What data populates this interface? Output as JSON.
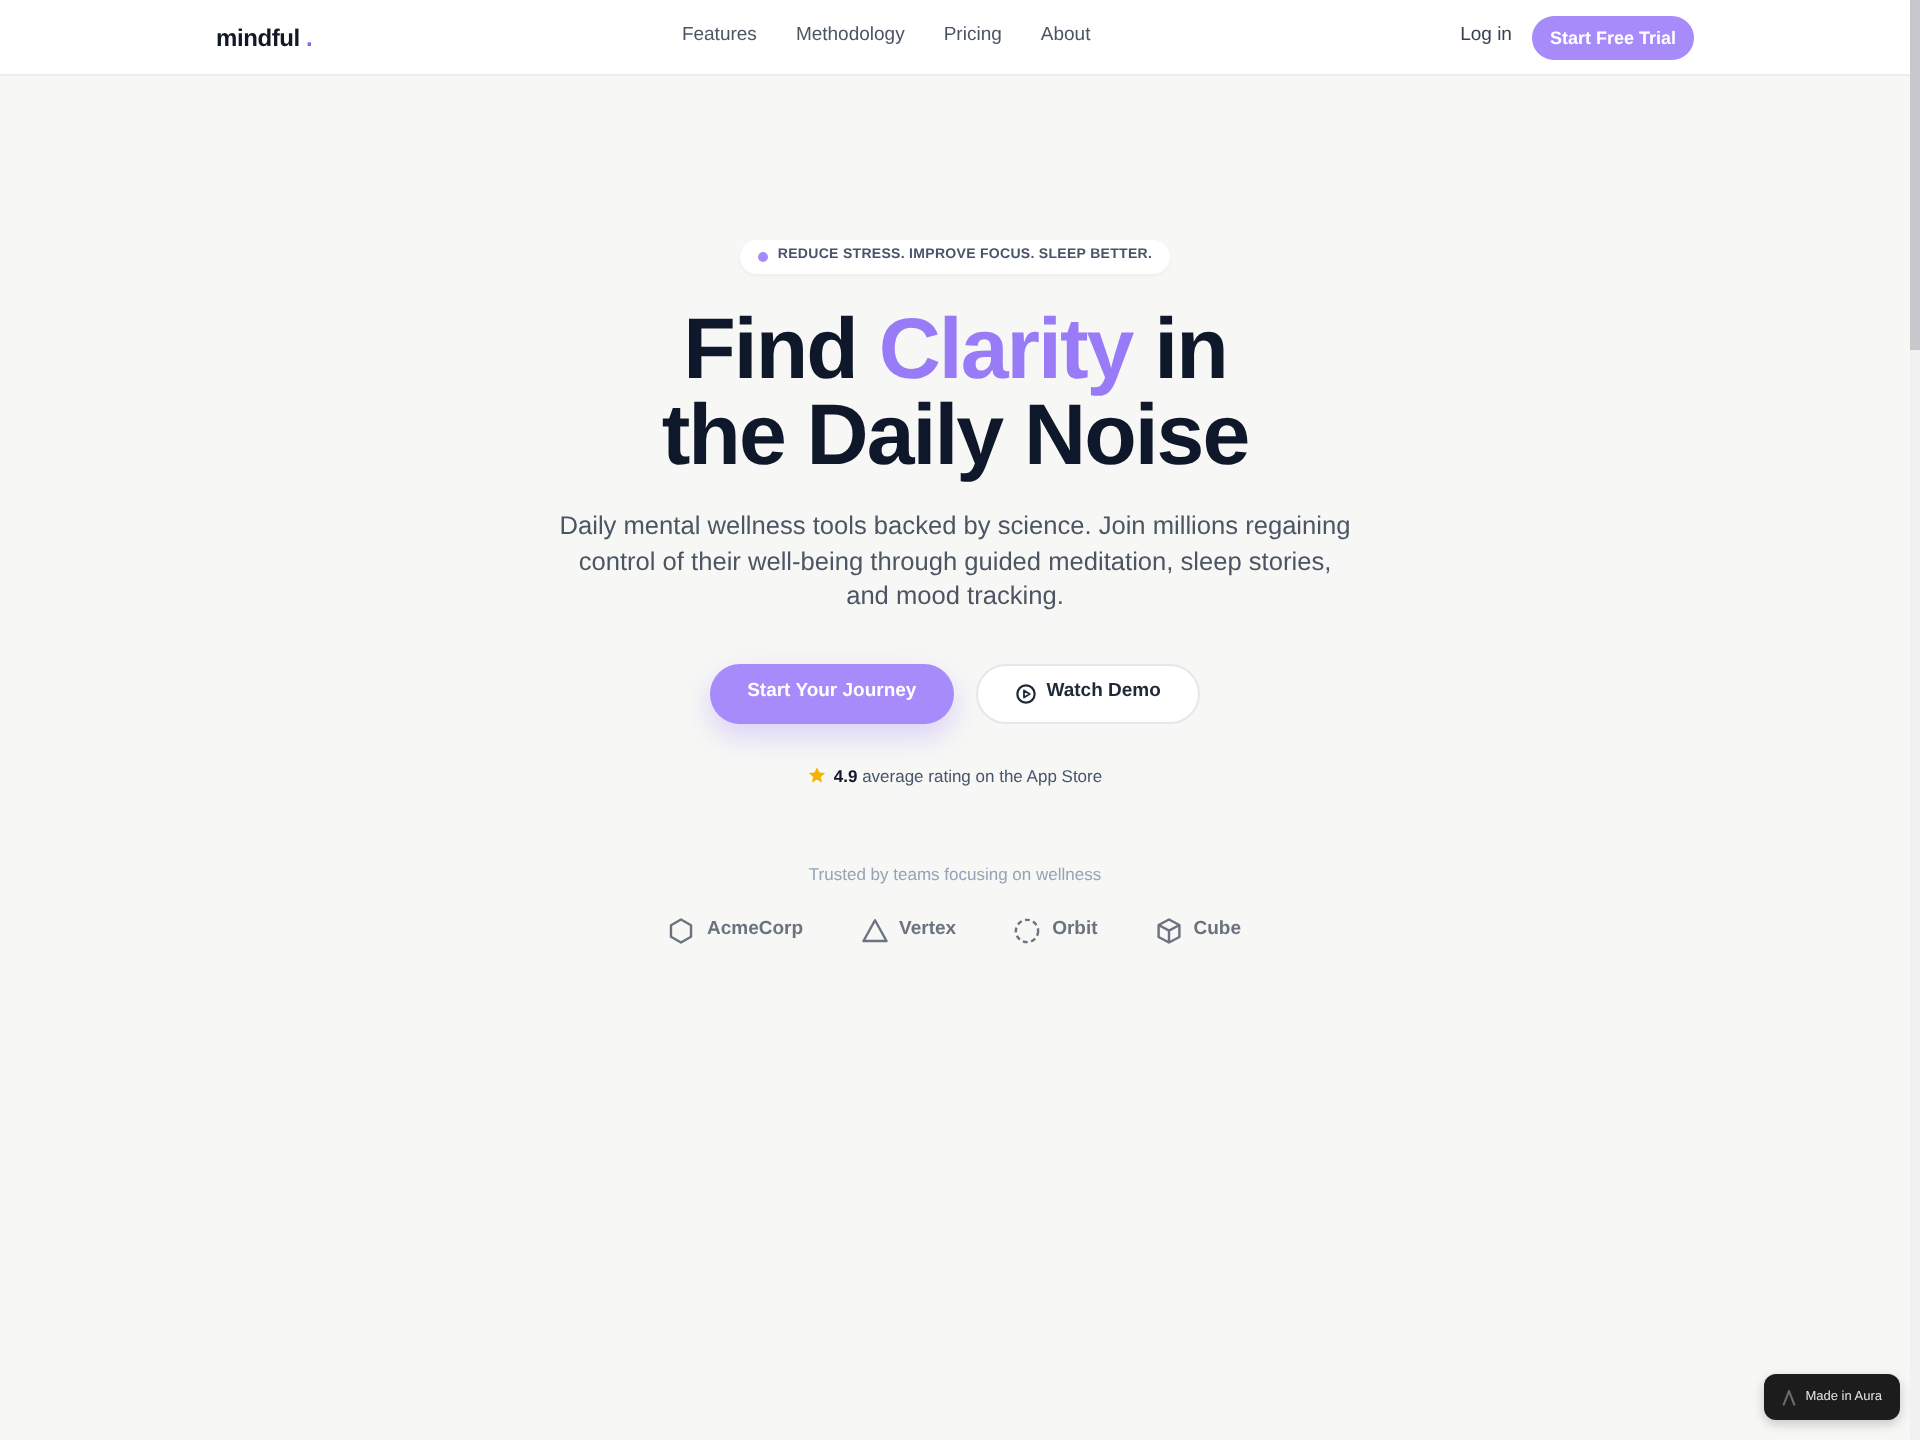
{
  "navbar": {
    "brand": {
      "name": "mindful",
      "mark": "."
    },
    "links": [
      "Features",
      "Methodology",
      "Pricing",
      "About"
    ],
    "login": "Log in",
    "cta": "Start Free Trial"
  },
  "hero": {
    "eyebrow": "REDUCE STRESS. IMPROVE FOCUS. SLEEP BETTER.",
    "headline": {
      "lead": "Find",
      "highlight": "Clarity",
      "tail": "in the Daily Noise"
    },
    "subtitle": "Daily mental wellness tools backed by science. Join millions regaining control of their well-being through guided meditation, sleep stories, and mood tracking.",
    "actions": [
      {
        "kind": "primary",
        "label": "Start Your Journey"
      },
      {
        "kind": "video",
        "label": "Watch Demo"
      }
    ],
    "rating": {
      "text": "**4.9** average rating on the App Store"
    }
  },
  "trusted": {
    "caption": "Trusted by teams focusing on wellness",
    "logos": [
      {
        "kind": "hexagon",
        "name": "AcmeCorp"
      },
      {
        "kind": "triangle",
        "name": "Vertex"
      },
      {
        "kind": "dashed-circle",
        "name": "Orbit"
      },
      {
        "kind": "cube",
        "name": "Cube"
      }
    ]
  },
  "made_in_badge": {
    "label": "Made in Aura"
  }
}
